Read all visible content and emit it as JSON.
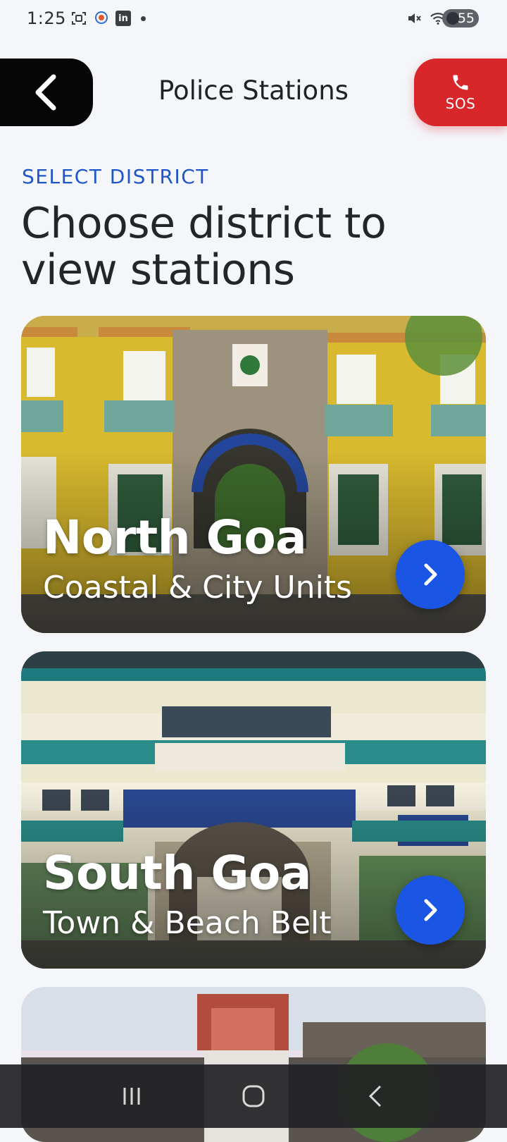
{
  "status_bar": {
    "time": "1:25",
    "battery": "55",
    "icons_left": [
      "screenshot-icon",
      "app-notification-icon",
      "linkedin-icon",
      "dot-icon"
    ],
    "icons_right": [
      "mute-icon",
      "wifi-icon",
      "signal-icon",
      "battery-icon"
    ],
    "linkedin_label": "in"
  },
  "header": {
    "title": "Police Stations",
    "sos_label": "SOS"
  },
  "section": {
    "eyebrow": "SELECT DISTRICT",
    "headline": "Choose district to view stations"
  },
  "districts": [
    {
      "name": "North Goa",
      "subtitle": "Coastal & City Units"
    },
    {
      "name": "South Goa",
      "subtitle": "Town & Beach Belt"
    },
    {
      "name": "",
      "subtitle": ""
    }
  ],
  "colors": {
    "accent": "#1a55e3",
    "eyebrow": "#2156c7",
    "sos": "#d8262b",
    "back": "#060606"
  }
}
